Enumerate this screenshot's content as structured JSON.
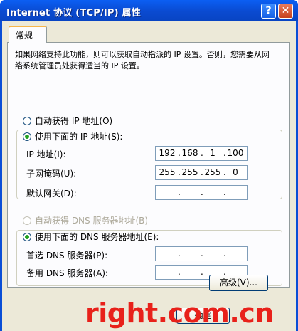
{
  "window": {
    "title": "Internet 协议 (TCP/IP) 属性",
    "help_label": "?",
    "close_label": "✕"
  },
  "tabs": [
    {
      "label": "常规"
    }
  ],
  "description": "如果网络支持此功能，则可以获取自动指派的 IP 设置。否则，您需要从网络系统管理员处获得适当的 IP 设置。",
  "ip_section": {
    "auto_label": "自动获得 IP 地址(O)",
    "manual_label": "使用下面的 IP 地址(S):",
    "selected": "manual",
    "fields": [
      {
        "label": "IP 地址(I):",
        "octets": [
          "192",
          "168",
          "1",
          "100"
        ]
      },
      {
        "label": "子网掩码(U):",
        "octets": [
          "255",
          "255",
          "255",
          "0"
        ]
      },
      {
        "label": "默认网关(D):",
        "octets": [
          "",
          "",
          "",
          ""
        ]
      }
    ]
  },
  "dns_section": {
    "auto_label": "自动获得 DNS 服务器地址(B)",
    "manual_label": "使用下面的 DNS 服务器地址(E):",
    "selected": "manual",
    "fields": [
      {
        "label": "首选 DNS 服务器(P):",
        "octets": [
          "",
          "",
          "",
          ""
        ]
      },
      {
        "label": "备用 DNS 服务器(A):",
        "octets": [
          "",
          "",
          "",
          ""
        ]
      }
    ]
  },
  "buttons": {
    "advanced_label": "高级(V)...",
    "ok_label": "确定"
  },
  "watermark": "right.com.cn",
  "colors": {
    "titlebar": "#0a4ed6",
    "dialog_bg": "#ece9d8",
    "radio_selected": "#21a121",
    "watermark": "#e8211a"
  }
}
